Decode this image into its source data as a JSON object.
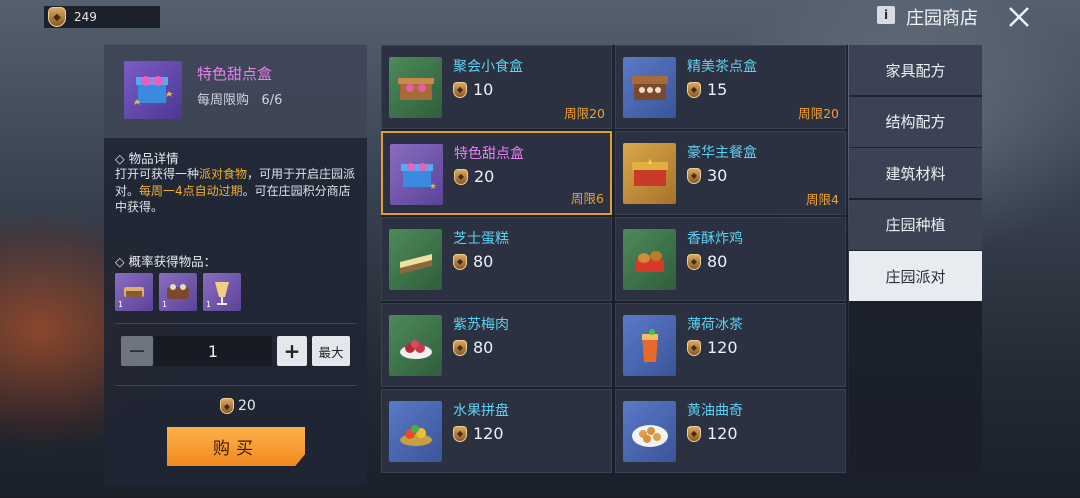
{
  "header": {
    "currency_value": "249",
    "info_label": "i",
    "title": "庄园商店"
  },
  "detail": {
    "name": "特色甜点盒",
    "limit_text": "每周限购",
    "limit_value": "6/6",
    "section_details": "◇ 物品详情",
    "desc_1": "打开可获得一种",
    "desc_hl1": "派对食物",
    "desc_2": "，可用于开启庄园派对。",
    "desc_hl2": "每周一4点自动过期",
    "desc_3": "。可在庄园积分商店中获得。",
    "section_drops": "◇ 概率获得物品：",
    "drops": [
      {
        "qty": "1"
      },
      {
        "qty": "1"
      },
      {
        "qty": "1"
      }
    ],
    "quantity": "1",
    "max_label": "最大",
    "total_price": "20",
    "buy_label": "购买"
  },
  "items": [
    {
      "name": "聚会小食盒",
      "price": "10",
      "limit": "周限20"
    },
    {
      "name": "精美茶点盒",
      "price": "15",
      "limit": "周限20"
    },
    {
      "name": "特色甜点盒",
      "price": "20",
      "limit": "周限6"
    },
    {
      "name": "豪华主餐盒",
      "price": "30",
      "limit": "周限4"
    },
    {
      "name": "芝士蛋糕",
      "price": "80",
      "limit": ""
    },
    {
      "name": "香酥炸鸡",
      "price": "80",
      "limit": ""
    },
    {
      "name": "紫苏梅肉",
      "price": "80",
      "limit": ""
    },
    {
      "name": "薄荷冰茶",
      "price": "120",
      "limit": ""
    },
    {
      "name": "水果拼盘",
      "price": "120",
      "limit": ""
    },
    {
      "name": "黄油曲奇",
      "price": "120",
      "limit": ""
    }
  ],
  "tabs": [
    {
      "label": "家具配方"
    },
    {
      "label": "结构配方"
    },
    {
      "label": "建筑材料"
    },
    {
      "label": "庄园种植"
    },
    {
      "label": "庄园派对"
    }
  ],
  "colors": {
    "accent_orange": "#f08a1e",
    "item_name_cyan": "#5fd0f0",
    "item_name_pink": "#e680f0",
    "limit_orange": "#f0a030"
  }
}
